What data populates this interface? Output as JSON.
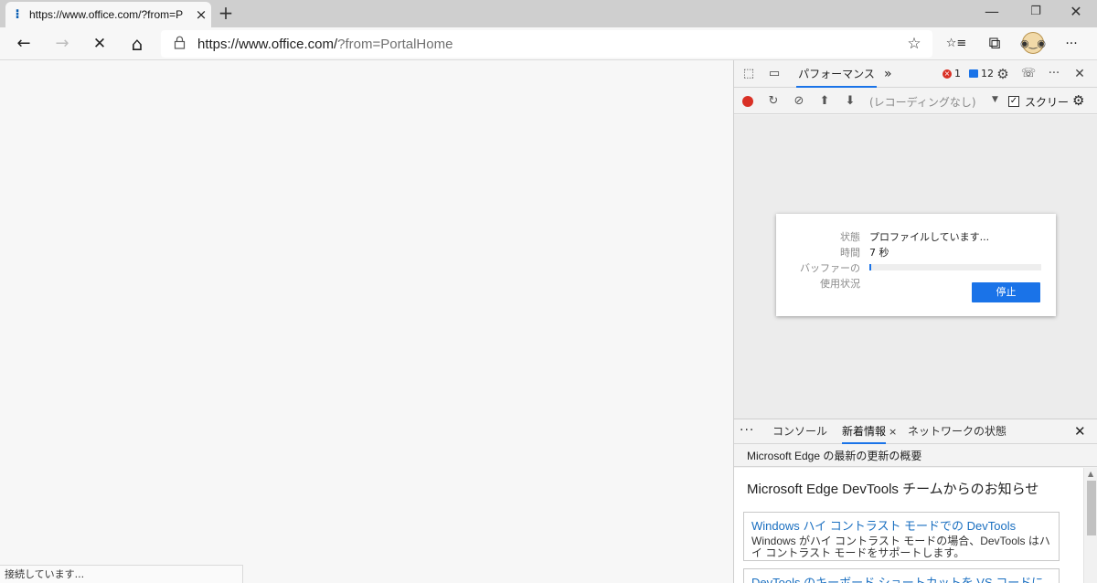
{
  "browser": {
    "tab_title": "https://www.office.com/?from=P",
    "tab_close": "×",
    "new_tab": "+",
    "window_controls": {
      "minimize": "—",
      "restore": "❐",
      "close": "✕"
    }
  },
  "toolbar": {
    "back": "←",
    "forward": "→",
    "stop": "✕",
    "home": "⌂",
    "url_host": "https://www.office.com/",
    "url_path": "?from=PortalHome",
    "favorite": "☆",
    "favorites": "☆≡",
    "collections": "⧉",
    "profile": "◉‿◉",
    "more": "···"
  },
  "status": {
    "text": "接続しています..."
  },
  "devtools": {
    "tabs": {
      "inspect_icon": "⬚",
      "device_icon": "▭",
      "performance_label": "パフォーマンス",
      "more_tabs": "»",
      "error_count": "1",
      "message_count": "12",
      "settings": "⚙",
      "feedback": "☏",
      "more": "···",
      "close": "✕"
    },
    "perf_toolbar": {
      "reload": "↻",
      "clear": "⊘",
      "upload": "⬆",
      "download": "⬇",
      "recording_select": "(レコーディングなし)",
      "caret": "▼",
      "check": "✓",
      "screenshot_label": "スクリー",
      "settings": "⚙"
    },
    "profiling_dialog": {
      "status_label": "状態",
      "status_value": "プロファイルしています...",
      "time_label": "時間",
      "time_value": "7 秒",
      "buffer_label_1": "バッファーの",
      "buffer_label_2": "使用状況",
      "buffer_usage": 0.01,
      "stop_label": "停止"
    },
    "drawer": {
      "more": "⋮⋮",
      "tabs": [
        {
          "label": "コンソール"
        },
        {
          "label": "新着情報",
          "close": "×"
        },
        {
          "label": "ネットワークの状態"
        }
      ],
      "close": "✕",
      "subheader": "Microsoft Edge の最新の更新の概要",
      "whats_new_title": "Microsoft Edge DevTools チームからのお知らせ",
      "cards": [
        {
          "title": "Windows ハイ コントラスト モードでの DevTools",
          "description": "Windows がハイ コントラスト モードの場合、DevTools はハイ コントラスト モードをサポートします。"
        },
        {
          "title": "DevTools のキーボード ショートカットを VS コードに",
          "description": ""
        }
      ]
    }
  }
}
